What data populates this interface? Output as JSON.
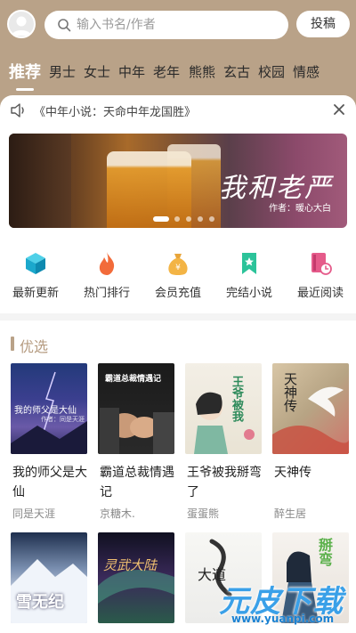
{
  "header": {
    "search_placeholder": "输入书名/作者",
    "submit_label": "投稿"
  },
  "tabs": [
    "推荐",
    "男士",
    "女士",
    "中年",
    "老年",
    "熊熊",
    "玄古",
    "校园",
    "情感"
  ],
  "active_tab": "推荐",
  "notice": {
    "text": "《中年小说：天命中年龙国胜》"
  },
  "banner": {
    "title": "我和老严",
    "author": "作者：暖心大白",
    "slides": 5,
    "active_slide": 1
  },
  "shortcuts": [
    {
      "label": "最新更新",
      "icon": "box-icon"
    },
    {
      "label": "热门排行",
      "icon": "fire-icon"
    },
    {
      "label": "会员充值",
      "icon": "money-bag-icon"
    },
    {
      "label": "完结小说",
      "icon": "bookmark-icon"
    },
    {
      "label": "最近阅读",
      "icon": "book-clock-icon"
    }
  ],
  "section": {
    "title": "优选"
  },
  "books": [
    {
      "title": "我的师父是大仙",
      "author": "同是天涯",
      "cover_text": "我的师父是大仙",
      "cover_sub": "作者：同是天涯"
    },
    {
      "title": "霸道总裁情遇记",
      "author": "京糖木.",
      "cover_text": "霸道总裁情遇记"
    },
    {
      "title": "王爷被我掰弯了",
      "author": "蛋蛋熊",
      "cover_text": "王爷被我"
    },
    {
      "title": "天神传",
      "author": "醉生居",
      "cover_text": "天神传"
    },
    {
      "title": "",
      "author": "",
      "cover_text": "雪无纪"
    },
    {
      "title": "",
      "author": "",
      "cover_text": "灵武大陆"
    },
    {
      "title": "",
      "author": "",
      "cover_text": "大道"
    },
    {
      "title": "",
      "author": "",
      "cover_text": "掰弯"
    }
  ],
  "watermark": {
    "brand": "元皮下载",
    "url": "www.yuanpi.com"
  },
  "colors": {
    "header_bg": "#b9a288",
    "accent": "#b59b80"
  }
}
